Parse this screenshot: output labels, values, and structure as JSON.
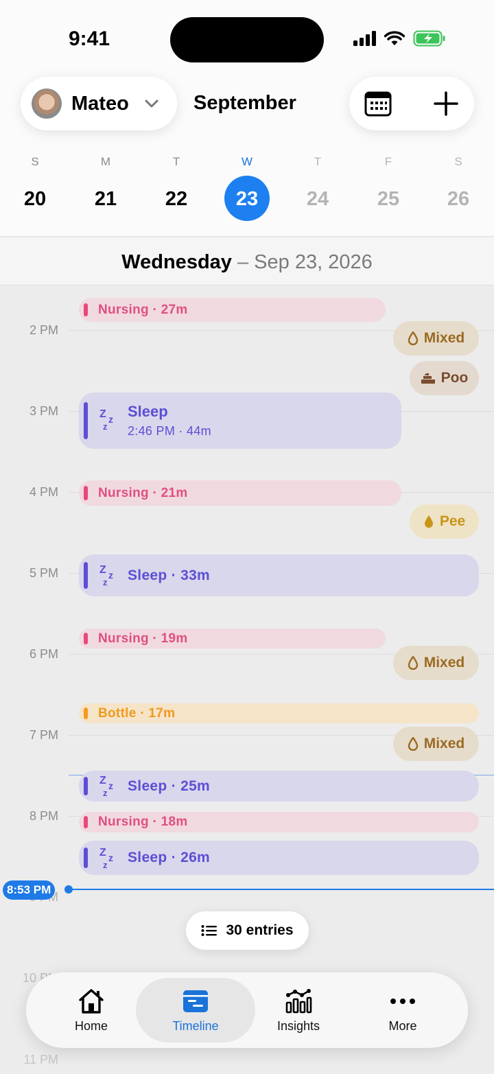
{
  "status_bar": {
    "time": "9:41"
  },
  "header": {
    "profile_name": "Mateo",
    "month": "September"
  },
  "week": [
    {
      "letter": "S",
      "number": "20",
      "state": "past"
    },
    {
      "letter": "M",
      "number": "21",
      "state": "past"
    },
    {
      "letter": "T",
      "number": "22",
      "state": "past"
    },
    {
      "letter": "W",
      "number": "23",
      "state": "selected"
    },
    {
      "letter": "T",
      "number": "24",
      "state": "future"
    },
    {
      "letter": "F",
      "number": "25",
      "state": "future"
    },
    {
      "letter": "S",
      "number": "26",
      "state": "future"
    }
  ],
  "date_bar": {
    "weekday": "Wednesday",
    "rest": " – Sep 23, 2026"
  },
  "hours": [
    "2 PM",
    "3 PM",
    "4 PM",
    "5 PM",
    "6 PM",
    "7 PM",
    "8 PM",
    "9 PM",
    "10 PM",
    "11 PM"
  ],
  "events": {
    "nursing_1": "Nursing · 27m",
    "sleep_1_title": "Sleep",
    "sleep_1_detail": "2:46 PM · 44m",
    "nursing_2": "Nursing · 21m",
    "sleep_2": "Sleep · 33m",
    "nursing_3": "Nursing · 19m",
    "bottle_1": "Bottle · 17m",
    "sleep_3": "Sleep · 25m",
    "nursing_4": "Nursing · 18m",
    "sleep_4": "Sleep · 26m"
  },
  "diapers": {
    "mixed_1": "Mixed",
    "poo_1": "Poo",
    "pee_1": "Pee",
    "mixed_2": "Mixed",
    "mixed_3": "Mixed"
  },
  "now_indicator": "8:53 PM",
  "entries_label": "30 entries",
  "tabs": [
    {
      "label": "Home"
    },
    {
      "label": "Timeline"
    },
    {
      "label": "Insights"
    },
    {
      "label": "More"
    }
  ],
  "colors": {
    "accent": "#1e80f0",
    "nursing": "#e8487a",
    "sleep": "#5b4fd4",
    "bottle": "#f49a20"
  }
}
